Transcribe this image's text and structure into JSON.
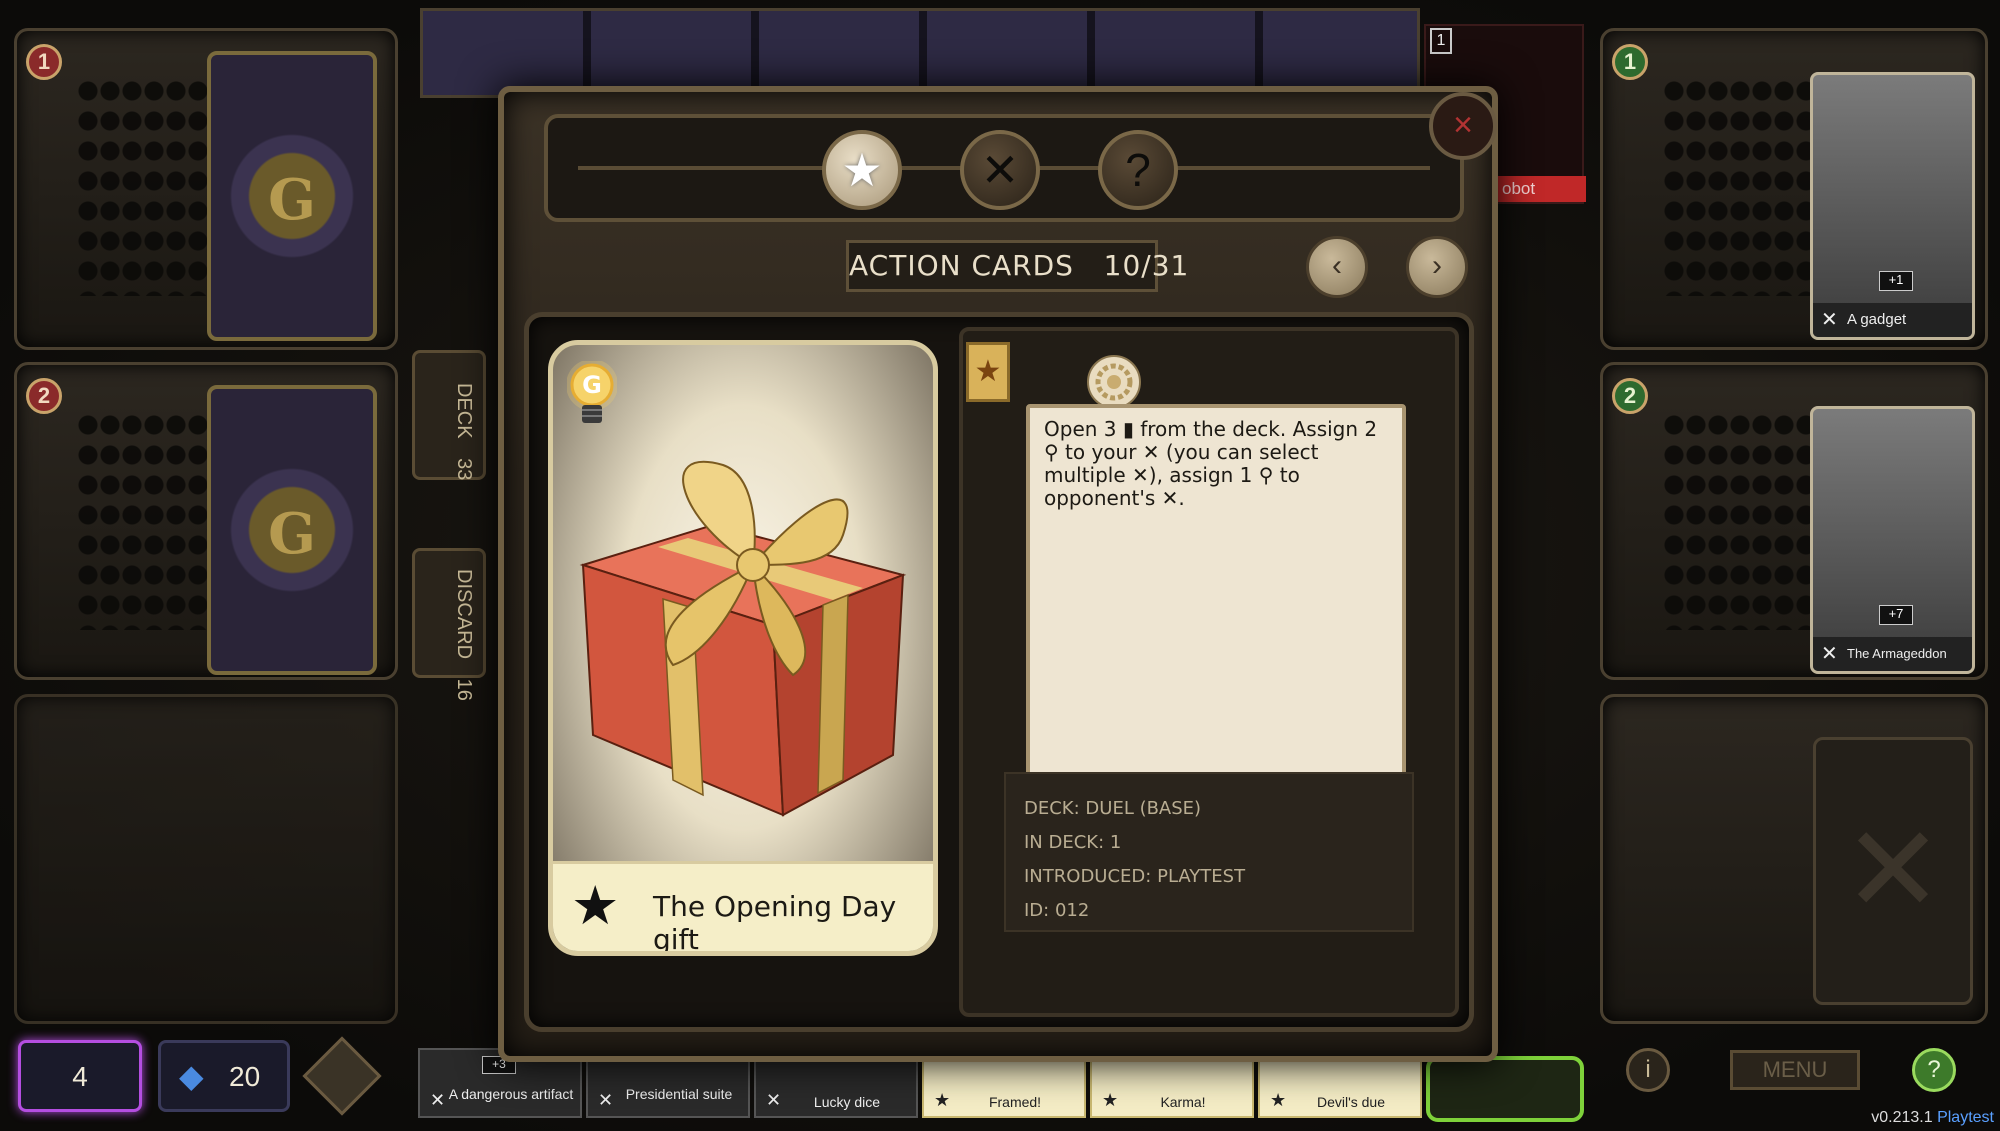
{
  "players_left": [
    {
      "badge": "1"
    },
    {
      "badge": "2"
    }
  ],
  "players_right": [
    {
      "badge": "1",
      "card_title": "A gadget",
      "card_badge": "+1"
    },
    {
      "badge": "2",
      "card_title": "The Armageddon Clock",
      "card_badge": "+7"
    }
  ],
  "deck_pile": {
    "label": "DECK",
    "count": "33"
  },
  "discard_pile": {
    "label": "DISCARD",
    "count": "16"
  },
  "robot_tag": {
    "num": "1",
    "label": "obot"
  },
  "modal": {
    "tabs": [
      {
        "name": "star",
        "glyph": "★"
      },
      {
        "name": "tools",
        "glyph": "✕"
      },
      {
        "name": "help",
        "glyph": "?"
      }
    ],
    "close_glyph": "×",
    "counter": "ACTION CARDS   10/31",
    "prev_glyph": "‹",
    "next_glyph": "›",
    "card": {
      "title": "The Opening Day gift",
      "star": "★",
      "type_badge": "★",
      "description": "Open 3 ▮ from the deck. Assign 2 ⚲ to your ✕ (you can select multiple ✕), assign 1 ⚲ to opponent's ✕.",
      "meta": [
        {
          "key": "Deck:",
          "value": "DUEL (BASE)"
        },
        {
          "key": "In deck:",
          "value": "1"
        },
        {
          "key": "Introduced:",
          "value": "PLAYTEST"
        },
        {
          "key": "ID:",
          "value": "012"
        }
      ]
    }
  },
  "hand_cards": [
    {
      "title": "A dangerous artifact",
      "icon": "✕",
      "style": "dark",
      "badge": "+3"
    },
    {
      "title": "Presidential suite",
      "icon": "✕",
      "style": "dark"
    },
    {
      "title": "Lucky dice",
      "icon": "✕",
      "style": "dark"
    },
    {
      "title": "Framed!",
      "icon": "★",
      "style": "yellow"
    },
    {
      "title": "Karma!",
      "icon": "★",
      "style": "yellow"
    },
    {
      "title": "Devil's due",
      "icon": "★",
      "style": "yellow"
    }
  ],
  "counters": {
    "energy": "4",
    "gems": "20"
  },
  "bottom_right": {
    "info": "i",
    "menu": "MENU",
    "help": "?"
  },
  "version": {
    "num": "v0.213.1",
    "tag": "Playtest"
  },
  "colors": {
    "accent_gold": "#d9b25a",
    "card_cream": "#eee5d2",
    "frame": "#6e5e42"
  }
}
